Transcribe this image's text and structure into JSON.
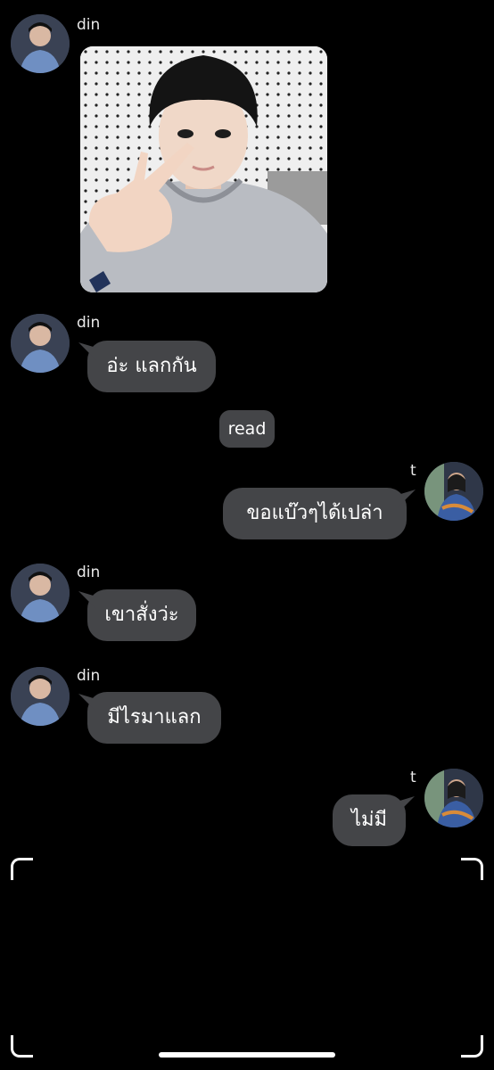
{
  "contacts": {
    "left": {
      "name": "din"
    },
    "right": {
      "name": "t"
    }
  },
  "messages": [
    {
      "sender": "din",
      "type": "image",
      "alt": ""
    },
    {
      "sender": "din",
      "type": "text",
      "text": "อ่ะ แลกกัน"
    },
    {
      "type": "status",
      "text": "read"
    },
    {
      "sender": "t",
      "type": "text",
      "text": "ขอแบ๊วๆได้เปล่า"
    },
    {
      "sender": "din",
      "type": "text",
      "text": "เขาสั่งว่ะ"
    },
    {
      "sender": "din",
      "type": "text",
      "text": "มีไรมาแลก"
    },
    {
      "sender": "t",
      "type": "text",
      "text": "ไม่มี"
    }
  ],
  "colors": {
    "background": "#000000",
    "bubble": "#444548",
    "text": "#ffffff"
  }
}
